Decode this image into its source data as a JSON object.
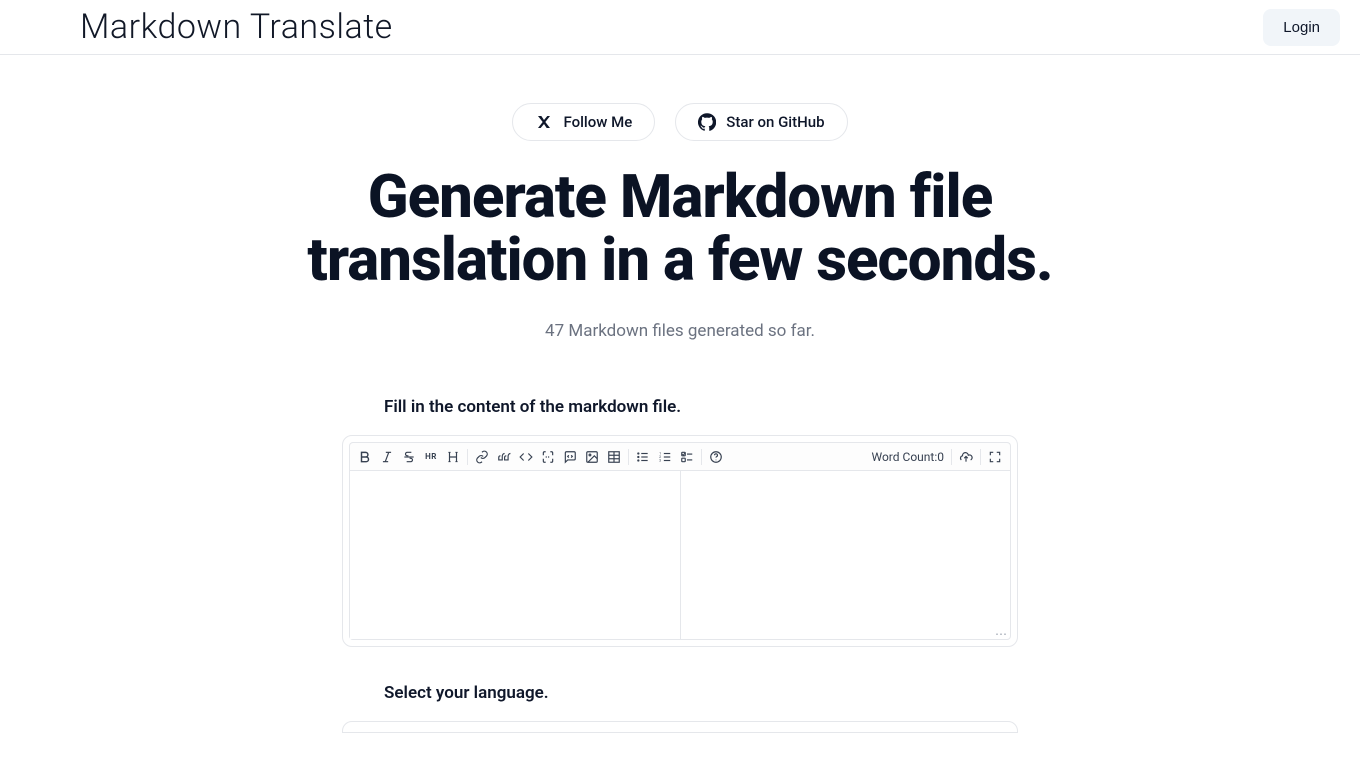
{
  "header": {
    "brand": "Markdown Translate",
    "login": "Login"
  },
  "hero": {
    "follow_label": "Follow Me",
    "star_label": "Star on GitHub",
    "title": "Generate Markdown file translation in a few seconds.",
    "subtitle": "47 Markdown files generated so far."
  },
  "editor": {
    "fill_label": "Fill in the content of the markdown file.",
    "word_count_label": "Word Count:",
    "word_count_value": "0",
    "textarea_value": ""
  },
  "language": {
    "select_label": "Select your language."
  }
}
